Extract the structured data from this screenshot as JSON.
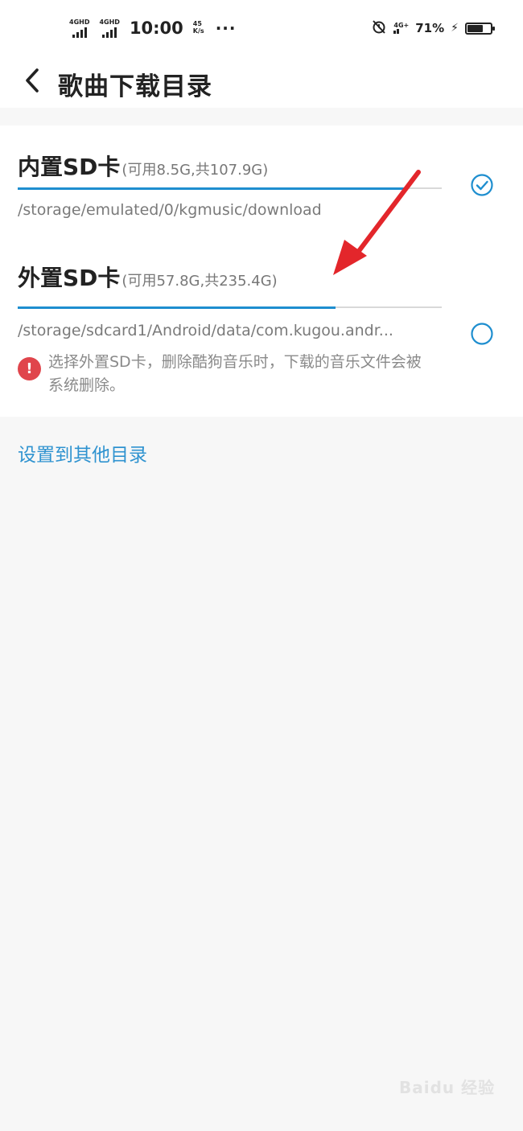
{
  "status_bar": {
    "sim1_label": "4GHD",
    "sim2_label": "4GHD",
    "time": "10:00",
    "net_speed_value": "45",
    "net_speed_unit": "K/s",
    "more": "···",
    "volte": "4G+",
    "battery_percent": "71%",
    "battery_level": 0.71,
    "icons": [
      "signal-icon",
      "alarm-off-icon",
      "charging-icon",
      "battery-icon"
    ]
  },
  "header": {
    "back_icon": "chevron-left-icon",
    "title": "歌曲下载目录"
  },
  "storage_options": [
    {
      "name": "内置SD卡",
      "capacity": "(可用8.5G,共107.9G)",
      "used_fraction": 0.92,
      "path": "/storage/emulated/0/kgmusic/download",
      "selected": true
    },
    {
      "name": "外置SD卡",
      "capacity": "(可用57.8G,共235.4G)",
      "used_fraction": 0.75,
      "path": "/storage/sdcard1/Android/data/com.kugou.andr...",
      "selected": false
    }
  ],
  "warning": {
    "icon": "exclamation-icon",
    "text": "选择外置SD卡，删除酷狗音乐时，下载的音乐文件会被系统删除。"
  },
  "other_dir_link": "设置到其他目录",
  "watermark": "Baidu 经验",
  "colors": {
    "accent": "#1e8ecf",
    "link": "#2f93d0",
    "warning": "#e0454c",
    "annotation_arrow": "#e3262b"
  }
}
